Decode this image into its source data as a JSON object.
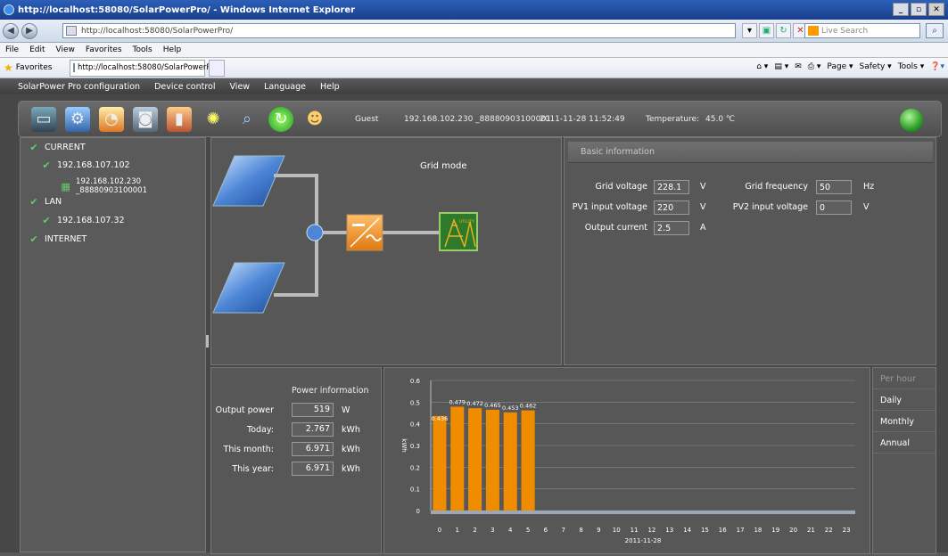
{
  "browser": {
    "title": "http://localhost:58080/SolarPowerPro/ - Windows Internet Explorer",
    "address": "http://localhost:58080/SolarPowerPro/",
    "search_placeholder": "Live Search",
    "menu": [
      "File",
      "Edit",
      "View",
      "Favorites",
      "Tools",
      "Help"
    ],
    "favorites_label": "Favorites",
    "tab_label": "http://localhost:58080/SolarPowerPro/",
    "commands": [
      "Page ▾",
      "Safety ▾",
      "Tools ▾"
    ]
  },
  "app_menu": [
    "SolarPower Pro configuration",
    "Device control",
    "View",
    "Language",
    "Help"
  ],
  "toolbar": {
    "user": "Guest",
    "device": "192.168.102.230 _88880903100001",
    "datetime": "2011-11-28 11:52:49",
    "temperature_label": "Temperature:",
    "temperature_value": "45.0 ℃"
  },
  "tree": {
    "current": "CURRENT",
    "current_ip": "192.168.107.102",
    "device": "192.168.102.230 _88880903100001",
    "lan": "LAN",
    "lan_ip": "192.168.107.32",
    "internet": "INTERNET"
  },
  "diagram": {
    "mode": "Grid mode",
    "utility_label": "UTILITY"
  },
  "basic": {
    "title": "Basic information",
    "grid_voltage_label": "Grid voltage",
    "grid_voltage": "228.1",
    "grid_voltage_unit": "V",
    "grid_freq_label": "Grid frequency",
    "grid_freq": "50",
    "grid_freq_unit": "Hz",
    "pv1_label": "PV1 input voltage",
    "pv1": "220",
    "pv1_unit": "V",
    "pv2_label": "PV2 input voltage",
    "pv2": "0",
    "pv2_unit": "V",
    "current_label": "Output current",
    "current": "2.5",
    "current_unit": "A"
  },
  "power": {
    "title": "Power information",
    "output_label": "Output power",
    "output": "519",
    "output_unit": "W",
    "today_label": "Today:",
    "today": "2.767",
    "today_unit": "kWh",
    "month_label": "This month:",
    "month": "6.971",
    "month_unit": "kWh",
    "year_label": "This year:",
    "year": "6.971",
    "year_unit": "kWh"
  },
  "chart_tabs": [
    "Per hour",
    "Daily",
    "Monthly",
    "Annual"
  ],
  "chart_data": {
    "type": "bar",
    "categories": [
      "0",
      "1",
      "2",
      "3",
      "4",
      "5",
      "6",
      "7",
      "8",
      "9",
      "10",
      "11",
      "12",
      "13",
      "14",
      "15",
      "16",
      "17",
      "18",
      "19",
      "20",
      "21",
      "22",
      "23"
    ],
    "values": [
      0.436,
      0.479,
      0.472,
      0.465,
      0.453,
      0.462,
      null,
      null,
      null,
      null,
      null,
      null,
      null,
      null,
      null,
      null,
      null,
      null,
      null,
      null,
      null,
      null,
      null,
      null
    ],
    "value_labels": [
      "0.436",
      "0.479",
      "0.472",
      "0.465",
      "0.453",
      "0.462"
    ],
    "ylabel": "kWh",
    "xlabel": "2011-11-28",
    "yticks": [
      "0",
      "0.1",
      "0.2",
      "0.3",
      "0.4",
      "0.5",
      "0.6"
    ],
    "ylim": [
      0,
      0.6
    ],
    "bar_color": "#f08c00"
  }
}
